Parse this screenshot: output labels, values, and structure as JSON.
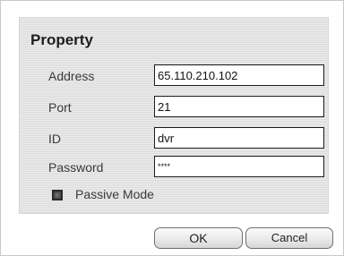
{
  "dialog": {
    "title": "Property"
  },
  "fields": {
    "address": {
      "label": "Address",
      "value": "65.110.210.102"
    },
    "port": {
      "label": "Port",
      "value": "21"
    },
    "id": {
      "label": "ID",
      "value": "dvr"
    },
    "password": {
      "label": "Password",
      "value": "****"
    }
  },
  "passive_mode": {
    "label": "Passive Mode",
    "checked": true
  },
  "buttons": {
    "ok_label": "OK",
    "cancel_label": "Cancel"
  }
}
